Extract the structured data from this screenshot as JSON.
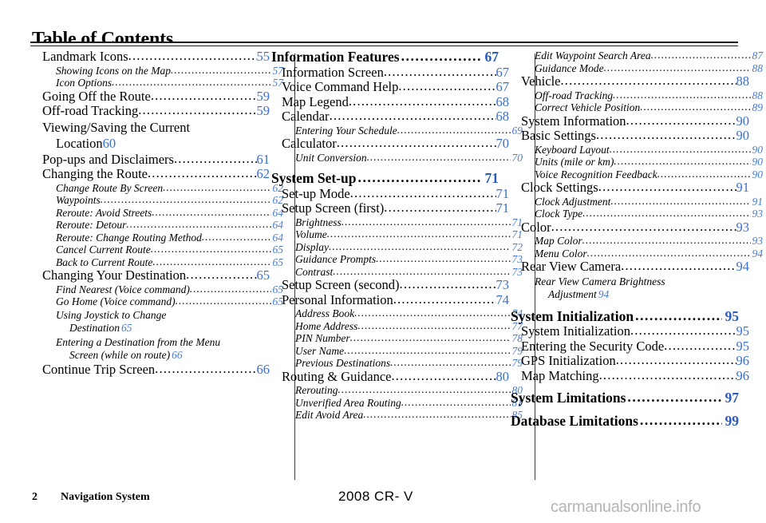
{
  "header": {
    "title": "Table of Contents"
  },
  "footer": {
    "page_number": "2",
    "book_title": "Navigation System",
    "model": "2008  CR- V",
    "watermark": "carmanualsonline.info"
  },
  "colors": {
    "page_number_blue": "#3a6fd0",
    "text_black": "#000000",
    "watermark_gray": "#b4b4b4"
  },
  "columns": [
    {
      "id": "column-1",
      "entries": [
        {
          "level": "section",
          "label": "Landmark Icons",
          "page": "55"
        },
        {
          "level": "subsection",
          "label": "Showing Icons on the Map",
          "page": "57"
        },
        {
          "level": "subsection",
          "label": "Icon Options",
          "page": "57"
        },
        {
          "level": "section",
          "label": "Going Off the Route",
          "page": "59"
        },
        {
          "level": "section",
          "label": "Off-road Tracking",
          "page": "59"
        },
        {
          "level": "section",
          "label": "Viewing/Saving the Current",
          "label2": "Location",
          "page": "60",
          "wrapped": true
        },
        {
          "level": "section",
          "label": "Pop-ups and Disclaimers",
          "page": "61"
        },
        {
          "level": "section",
          "label": "Changing the Route",
          "page": "62"
        },
        {
          "level": "subsection",
          "label": "Change Route By Screen",
          "page": "62"
        },
        {
          "level": "subsection",
          "label": "Waypoints",
          "page": "62"
        },
        {
          "level": "subsection",
          "label": "Reroute: Avoid Streets",
          "page": "64"
        },
        {
          "level": "subsection",
          "label": "Reroute: Detour",
          "page": "64"
        },
        {
          "level": "subsection",
          "label": "Reroute: Change Routing Method",
          "page": "64"
        },
        {
          "level": "subsection",
          "label": "Cancel Current Route",
          "page": "65"
        },
        {
          "level": "subsection",
          "label": "Back to Current Route",
          "page": "65"
        },
        {
          "level": "section",
          "label": "Changing Your Destination",
          "page": "65"
        },
        {
          "level": "subsection",
          "label": "Find Nearest (Voice command)",
          "page": "65"
        },
        {
          "level": "subsection",
          "label": "Go Home (Voice command)",
          "page": "65"
        },
        {
          "level": "subsection",
          "label": "Using Joystick to Change",
          "label2": "Destination",
          "page": "65",
          "wrapped": true
        },
        {
          "level": "subsection",
          "label": "Entering a Destination from the Menu",
          "label2": "Screen (while on route)",
          "page": "66",
          "wrapped": true
        },
        {
          "level": "section",
          "label": "Continue Trip Screen",
          "page": "66"
        }
      ]
    },
    {
      "id": "column-2",
      "entries": [
        {
          "level": "chapter",
          "label": "Information Features",
          "page": "67"
        },
        {
          "level": "section",
          "label": "Information Screen",
          "page": "67"
        },
        {
          "level": "section",
          "label": "Voice Command Help",
          "page": "67"
        },
        {
          "level": "section",
          "label": "Map Legend",
          "page": "68"
        },
        {
          "level": "section",
          "label": "Calendar",
          "page": "68"
        },
        {
          "level": "subsection",
          "label": "Entering Your Schedule",
          "page": "69"
        },
        {
          "level": "section",
          "label": "Calculator",
          "page": "70"
        },
        {
          "level": "subsection",
          "label": "Unit Conversion",
          "page": "70"
        },
        {
          "level": "chapter",
          "label": "System Set-up",
          "page": "71"
        },
        {
          "level": "section",
          "label": "Set-up Mode",
          "page": "71"
        },
        {
          "level": "section",
          "label": "Setup Screen (first)",
          "page": "71"
        },
        {
          "level": "subsection",
          "label": "Brightness",
          "page": "71"
        },
        {
          "level": "subsection",
          "label": "Volume",
          "page": "71"
        },
        {
          "level": "subsection",
          "label": "Display",
          "page": "72"
        },
        {
          "level": "subsection",
          "label": "Guidance Prompts",
          "page": "73"
        },
        {
          "level": "subsection",
          "label": "Contrast",
          "page": "73"
        },
        {
          "level": "section",
          "label": "Setup Screen (second)",
          "page": "73"
        },
        {
          "level": "section",
          "label": "Personal Information",
          "page": "74"
        },
        {
          "level": "subsection",
          "label": "Address Book",
          "page": "74"
        },
        {
          "level": "subsection",
          "label": "Home Address",
          "page": "77"
        },
        {
          "level": "subsection",
          "label": "PIN Number",
          "page": "78"
        },
        {
          "level": "subsection",
          "label": "User Name",
          "page": "79"
        },
        {
          "level": "subsection",
          "label": "Previous Destinations",
          "page": "79"
        },
        {
          "level": "section",
          "label": "Routing & Guidance",
          "page": "80"
        },
        {
          "level": "subsection",
          "label": "Rerouting",
          "page": "80"
        },
        {
          "level": "subsection",
          "label": "Unverified Area Routing",
          "page": "81"
        },
        {
          "level": "subsection",
          "label": "Edit Avoid Area",
          "page": "85"
        }
      ]
    },
    {
      "id": "column-3",
      "entries": [
        {
          "level": "subsection",
          "label": "Edit Waypoint Search Area",
          "page": "87"
        },
        {
          "level": "subsection",
          "label": "Guidance Mode",
          "page": "88"
        },
        {
          "level": "section",
          "label": "Vehicle",
          "page": "88"
        },
        {
          "level": "subsection",
          "label": "Off-road Tracking",
          "page": "88"
        },
        {
          "level": "subsection",
          "label": "Correct Vehicle Position",
          "page": "89"
        },
        {
          "level": "section",
          "label": "System Information",
          "page": "90"
        },
        {
          "level": "section",
          "label": "Basic Settings",
          "page": "90"
        },
        {
          "level": "subsection",
          "label": "Keyboard Layout",
          "page": "90"
        },
        {
          "level": "subsection",
          "label": "Units (mile or km)",
          "page": "90"
        },
        {
          "level": "subsection",
          "label": "Voice Recognition Feedback",
          "page": "90"
        },
        {
          "level": "section",
          "label": "Clock Settings",
          "page": "91"
        },
        {
          "level": "subsection",
          "label": "Clock Adjustment",
          "page": "91"
        },
        {
          "level": "subsection",
          "label": "Clock Type",
          "page": "93"
        },
        {
          "level": "section",
          "label": "Color",
          "page": "93"
        },
        {
          "level": "subsection",
          "label": "Map Color",
          "page": "93"
        },
        {
          "level": "subsection",
          "label": "Menu Color",
          "page": "94"
        },
        {
          "level": "section",
          "label": "Rear View Camera",
          "page": "94"
        },
        {
          "level": "subsection",
          "label": "Rear View Camera Brightness",
          "label2": "Adjustment",
          "page": "94",
          "wrapped": true
        },
        {
          "level": "chapter",
          "label": "System Initialization",
          "page": "95"
        },
        {
          "level": "section",
          "label": "System Initialization",
          "page": "95"
        },
        {
          "level": "section",
          "label": "Entering the Security Code",
          "page": "95"
        },
        {
          "level": "section",
          "label": "GPS Initialization",
          "page": "96"
        },
        {
          "level": "section",
          "label": "Map Matching",
          "page": "96"
        },
        {
          "level": "chapter",
          "label": "System Limitations",
          "page": "97"
        },
        {
          "level": "chapter",
          "label": "Database Limitations",
          "page": "99"
        }
      ]
    }
  ]
}
